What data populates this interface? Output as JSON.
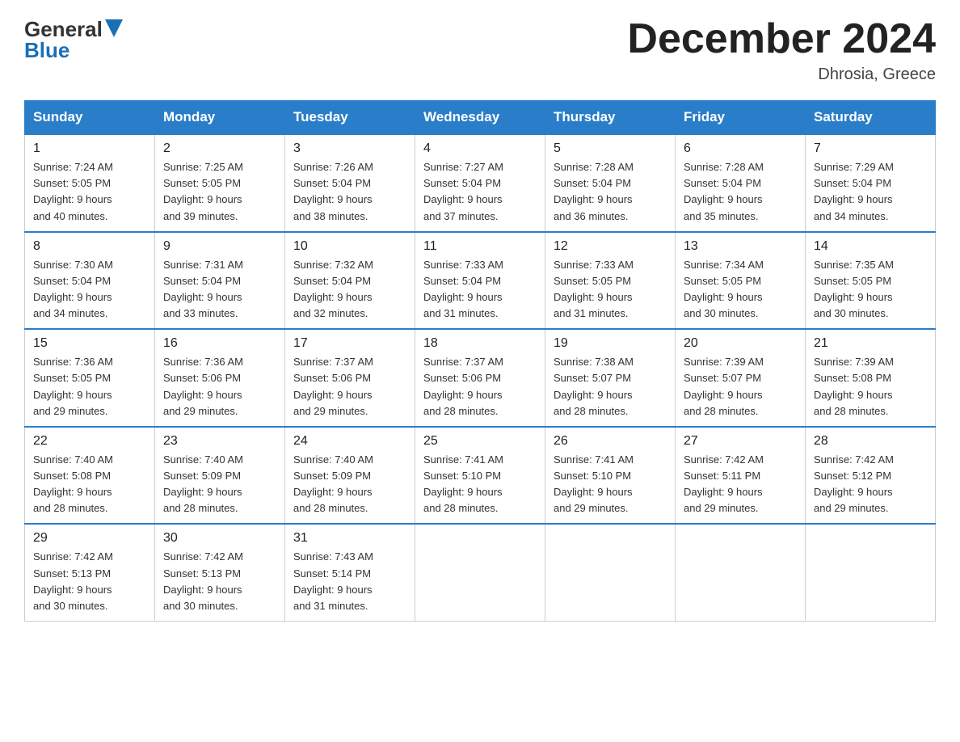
{
  "logo": {
    "part1": "General",
    "part2": "Blue"
  },
  "title": "December 2024",
  "subtitle": "Dhrosia, Greece",
  "days_of_week": [
    "Sunday",
    "Monday",
    "Tuesday",
    "Wednesday",
    "Thursday",
    "Friday",
    "Saturday"
  ],
  "weeks": [
    [
      {
        "day": "1",
        "sunrise": "7:24 AM",
        "sunset": "5:05 PM",
        "daylight": "9 hours and 40 minutes."
      },
      {
        "day": "2",
        "sunrise": "7:25 AM",
        "sunset": "5:05 PM",
        "daylight": "9 hours and 39 minutes."
      },
      {
        "day": "3",
        "sunrise": "7:26 AM",
        "sunset": "5:04 PM",
        "daylight": "9 hours and 38 minutes."
      },
      {
        "day": "4",
        "sunrise": "7:27 AM",
        "sunset": "5:04 PM",
        "daylight": "9 hours and 37 minutes."
      },
      {
        "day": "5",
        "sunrise": "7:28 AM",
        "sunset": "5:04 PM",
        "daylight": "9 hours and 36 minutes."
      },
      {
        "day": "6",
        "sunrise": "7:28 AM",
        "sunset": "5:04 PM",
        "daylight": "9 hours and 35 minutes."
      },
      {
        "day": "7",
        "sunrise": "7:29 AM",
        "sunset": "5:04 PM",
        "daylight": "9 hours and 34 minutes."
      }
    ],
    [
      {
        "day": "8",
        "sunrise": "7:30 AM",
        "sunset": "5:04 PM",
        "daylight": "9 hours and 34 minutes."
      },
      {
        "day": "9",
        "sunrise": "7:31 AM",
        "sunset": "5:04 PM",
        "daylight": "9 hours and 33 minutes."
      },
      {
        "day": "10",
        "sunrise": "7:32 AM",
        "sunset": "5:04 PM",
        "daylight": "9 hours and 32 minutes."
      },
      {
        "day": "11",
        "sunrise": "7:33 AM",
        "sunset": "5:04 PM",
        "daylight": "9 hours and 31 minutes."
      },
      {
        "day": "12",
        "sunrise": "7:33 AM",
        "sunset": "5:05 PM",
        "daylight": "9 hours and 31 minutes."
      },
      {
        "day": "13",
        "sunrise": "7:34 AM",
        "sunset": "5:05 PM",
        "daylight": "9 hours and 30 minutes."
      },
      {
        "day": "14",
        "sunrise": "7:35 AM",
        "sunset": "5:05 PM",
        "daylight": "9 hours and 30 minutes."
      }
    ],
    [
      {
        "day": "15",
        "sunrise": "7:36 AM",
        "sunset": "5:05 PM",
        "daylight": "9 hours and 29 minutes."
      },
      {
        "day": "16",
        "sunrise": "7:36 AM",
        "sunset": "5:06 PM",
        "daylight": "9 hours and 29 minutes."
      },
      {
        "day": "17",
        "sunrise": "7:37 AM",
        "sunset": "5:06 PM",
        "daylight": "9 hours and 29 minutes."
      },
      {
        "day": "18",
        "sunrise": "7:37 AM",
        "sunset": "5:06 PM",
        "daylight": "9 hours and 28 minutes."
      },
      {
        "day": "19",
        "sunrise": "7:38 AM",
        "sunset": "5:07 PM",
        "daylight": "9 hours and 28 minutes."
      },
      {
        "day": "20",
        "sunrise": "7:39 AM",
        "sunset": "5:07 PM",
        "daylight": "9 hours and 28 minutes."
      },
      {
        "day": "21",
        "sunrise": "7:39 AM",
        "sunset": "5:08 PM",
        "daylight": "9 hours and 28 minutes."
      }
    ],
    [
      {
        "day": "22",
        "sunrise": "7:40 AM",
        "sunset": "5:08 PM",
        "daylight": "9 hours and 28 minutes."
      },
      {
        "day": "23",
        "sunrise": "7:40 AM",
        "sunset": "5:09 PM",
        "daylight": "9 hours and 28 minutes."
      },
      {
        "day": "24",
        "sunrise": "7:40 AM",
        "sunset": "5:09 PM",
        "daylight": "9 hours and 28 minutes."
      },
      {
        "day": "25",
        "sunrise": "7:41 AM",
        "sunset": "5:10 PM",
        "daylight": "9 hours and 28 minutes."
      },
      {
        "day": "26",
        "sunrise": "7:41 AM",
        "sunset": "5:10 PM",
        "daylight": "9 hours and 29 minutes."
      },
      {
        "day": "27",
        "sunrise": "7:42 AM",
        "sunset": "5:11 PM",
        "daylight": "9 hours and 29 minutes."
      },
      {
        "day": "28",
        "sunrise": "7:42 AM",
        "sunset": "5:12 PM",
        "daylight": "9 hours and 29 minutes."
      }
    ],
    [
      {
        "day": "29",
        "sunrise": "7:42 AM",
        "sunset": "5:13 PM",
        "daylight": "9 hours and 30 minutes."
      },
      {
        "day": "30",
        "sunrise": "7:42 AM",
        "sunset": "5:13 PM",
        "daylight": "9 hours and 30 minutes."
      },
      {
        "day": "31",
        "sunrise": "7:43 AM",
        "sunset": "5:14 PM",
        "daylight": "9 hours and 31 minutes."
      },
      null,
      null,
      null,
      null
    ]
  ],
  "labels": {
    "sunrise": "Sunrise:",
    "sunset": "Sunset:",
    "daylight": "Daylight:"
  }
}
